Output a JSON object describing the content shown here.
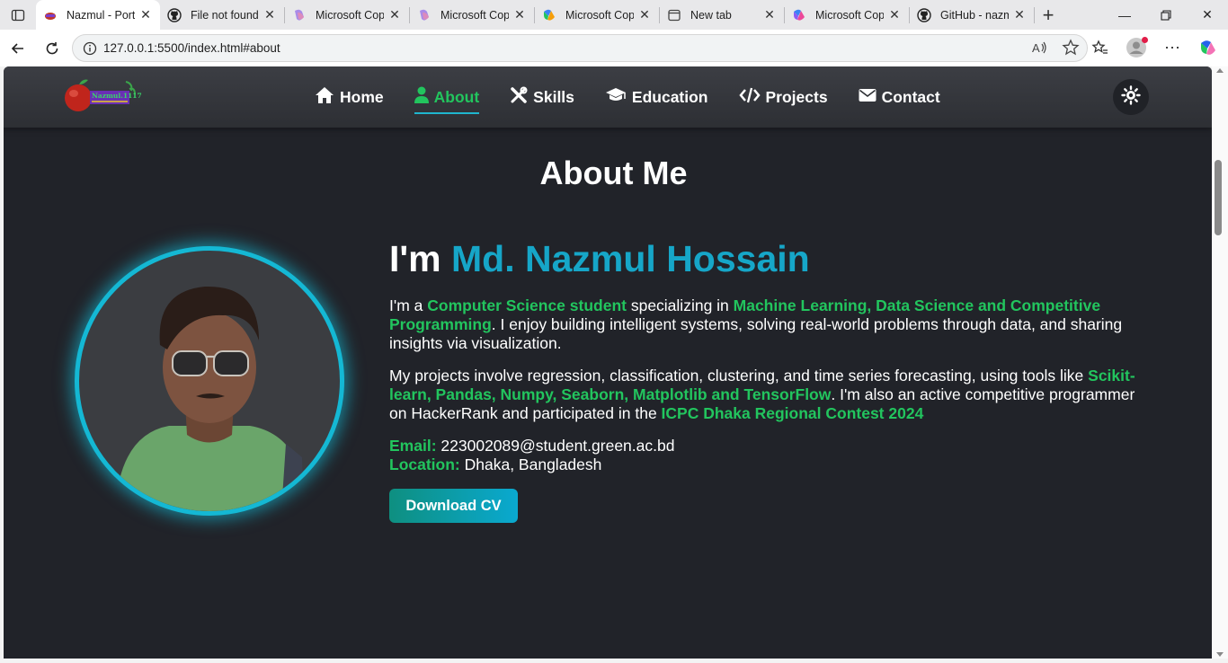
{
  "browser": {
    "tabs": [
      {
        "title": "Nazmul - Portf",
        "icon": "portfolio-favicon",
        "active": true
      },
      {
        "title": "File not found",
        "icon": "github-icon"
      },
      {
        "title": "Microsoft Cop",
        "icon": "copilot-icon"
      },
      {
        "title": "Microsoft Cop",
        "icon": "copilot-icon"
      },
      {
        "title": "Microsoft Cop",
        "icon": "copilot-icon"
      },
      {
        "title": "New tab",
        "icon": "new-tab-icon"
      },
      {
        "title": "Microsoft Cop",
        "icon": "copilot-icon"
      },
      {
        "title": "GitHub - nazm",
        "icon": "github-icon"
      }
    ],
    "url": "127.0.0.1:5500/index.html#about"
  },
  "site": {
    "logo_text": "Nazmul.1117",
    "nav": [
      {
        "label": "Home",
        "icon": "home-icon"
      },
      {
        "label": "About",
        "icon": "user-icon",
        "active": true
      },
      {
        "label": "Skills",
        "icon": "tools-icon"
      },
      {
        "label": "Education",
        "icon": "graduation-cap-icon"
      },
      {
        "label": "Projects",
        "icon": "code-icon"
      },
      {
        "label": "Contact",
        "icon": "envelope-icon"
      }
    ],
    "theme_toggle_icon": "sun-icon"
  },
  "about": {
    "title": "About Me",
    "greeting_prefix": "I'm",
    "name": "Md. Nazmul Hossain",
    "p1_a": "I'm a ",
    "p1_hl1": "Computer Science student",
    "p1_b": " specializing in ",
    "p1_hl2": "Machine Learning, Data Science and Competitive Programming",
    "p1_c": ". I enjoy building intelligent systems, solving real-world problems through data, and sharing insights via visualization.",
    "p2_a": "My projects involve regression, classification, clustering, and time series forecasting, using tools like ",
    "p2_hl1": "Scikit-learn, Pandas, Numpy, Seaborn, Matplotlib and TensorFlow",
    "p2_b": ". I'm also an active competitive programmer on HackerRank and participated in the ",
    "p2_hl2": "ICPC Dhaka Regional Contest 2024",
    "email_label": "Email:",
    "email": "223002089@student.green.ac.bd",
    "location_label": "Location:",
    "location": "Dhaka, Bangladesh",
    "cv_button": "Download CV"
  },
  "colors": {
    "accent_green": "#22c55e",
    "accent_cyan": "#16a6c8",
    "page_bg": "#212329"
  }
}
